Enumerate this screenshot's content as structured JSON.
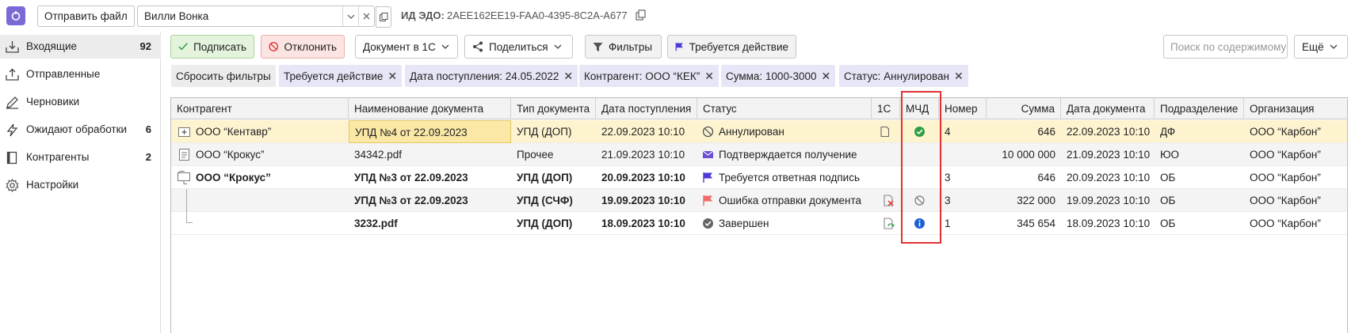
{
  "topbar": {
    "send_file": "Отправить файл",
    "org_value": "Вилли Вонка",
    "edo_label": "ИД ЭДО:",
    "edo_value": "2AEE162EE19-FAA0-4395-8C2A-A677"
  },
  "sidebar": {
    "items": [
      {
        "label": "Входящие",
        "count": "92",
        "icon": "inbox-icon"
      },
      {
        "label": "Отправленные",
        "count": "",
        "icon": "outbox-icon"
      },
      {
        "label": "Черновики",
        "count": "",
        "icon": "pencil-icon"
      },
      {
        "label": "Ожидают обработки",
        "count": "6",
        "icon": "lightning-icon"
      },
      {
        "label": "Контрагенты",
        "count": "2",
        "icon": "book-icon"
      },
      {
        "label": "Настройки",
        "count": "",
        "icon": "gear-icon"
      }
    ]
  },
  "toolbar": {
    "sign": "Подписать",
    "reject": "Отклонить",
    "doc_1c": "Документ в 1С",
    "share": "Поделиться",
    "filters": "Фильтры",
    "action_required": "Требуется действие",
    "search_placeholder": "Поиск по содержимому",
    "more": "Ещё"
  },
  "chips": {
    "reset": "Сбросить фильтры",
    "items": [
      "Требуется действие",
      "Дата поступления: 24.05.2022",
      "Контрагент: ООО “КЕК”",
      "Сумма: 1000-3000",
      "Статус: Аннулирован"
    ]
  },
  "table": {
    "columns": [
      "Контрагент",
      "Наименование документа",
      "Тип документа",
      "Дата поступления",
      "Статус",
      "1С",
      "МЧД",
      "Номер",
      "Сумма",
      "Дата документа",
      "Подразделение",
      "Организация"
    ],
    "rows": [
      {
        "counterparty": "ООО “Кентавр”",
        "name": "УПД №4 от 22.09.2023",
        "type": "УПД (ДОП)",
        "received": "22.09.2023 10:10",
        "status": "Аннулирован",
        "number": "4",
        "sum": "646",
        "doc_date": "22.09.2023 10:10",
        "dept": "ДФ",
        "org": "ООО “Карбон”"
      },
      {
        "counterparty": "ООО “Крокус”",
        "name": "34342.pdf",
        "type": "Прочее",
        "received": "21.09.2023 10:10",
        "status": "Подтверждается получение",
        "number": "",
        "sum": "10 000 000",
        "doc_date": "21.09.2023 10:10",
        "dept": "ЮО",
        "org": "ООО “Карбон”"
      },
      {
        "counterparty": "ООО “Крокус”",
        "name": "УПД №3 от 22.09.2023",
        "type": "УПД (ДОП)",
        "received": "20.09.2023 10:10",
        "status": "Требуется ответная подпись",
        "number": "3",
        "sum": "646",
        "doc_date": "20.09.2023 10:10",
        "dept": "ОБ",
        "org": "ООО “Карбон”"
      },
      {
        "counterparty": "",
        "name": "УПД №3 от 22.09.2023",
        "type": "УПД (СЧФ)",
        "received": "19.09.2023 10:10",
        "status": "Ошибка отправки документа",
        "number": "3",
        "sum": "322 000",
        "doc_date": "19.09.2023 10:10",
        "dept": "ОБ",
        "org": "ООО “Карбон”"
      },
      {
        "counterparty": "",
        "name": "3232.pdf",
        "type": "УПД (ДОП)",
        "received": "18.09.2023 10:10",
        "status": "Завершен",
        "number": "1",
        "sum": "345 654",
        "doc_date": "18.09.2023 10:10",
        "dept": "ОБ",
        "org": "ООО “Карбон”"
      }
    ]
  },
  "colors": {
    "accent": "#7b6ad6",
    "highlight": "#e03131",
    "selected_row": "#fdf3cf"
  }
}
